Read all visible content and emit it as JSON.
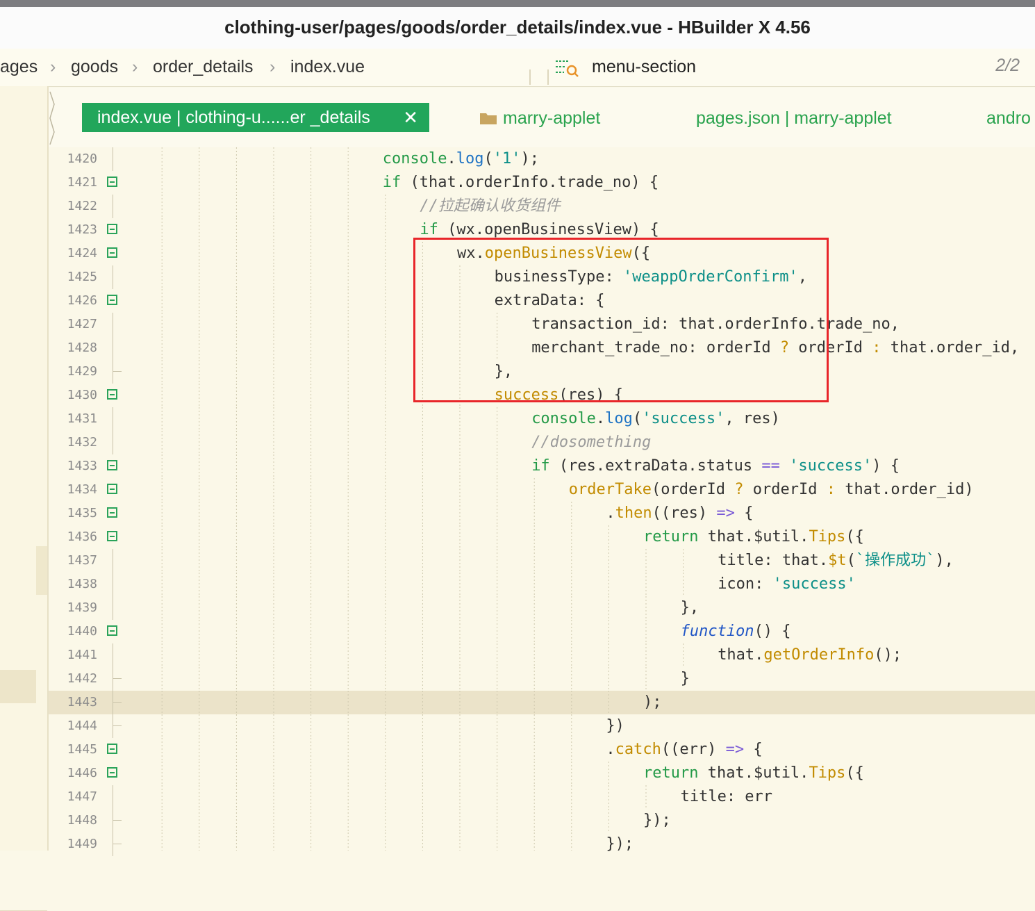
{
  "window": {
    "title": "clothing-user/pages/goods/order_details/index.vue - HBuilder X 4.56"
  },
  "breadcrumb": {
    "items": [
      "ages",
      "goods",
      "order_details",
      "index.vue"
    ],
    "outline_label": "menu-section",
    "match_count": "2/2"
  },
  "tabs": {
    "active": "index.vue | clothing-u......er _details",
    "others": [
      "marry-applet",
      "pages.json | marry-applet",
      "andro"
    ]
  },
  "colors": {
    "accent": "#22a65b",
    "highlight_box": "#e8262a",
    "background": "#fbf8e8"
  },
  "editor": {
    "current_line": 1443,
    "lines": [
      {
        "n": "1420",
        "fold": "",
        "indent": 8,
        "html": "<span class=\"g\">console</span>.<span class=\"b\">log</span>(<span class=\"s\">'1'</span>);"
      },
      {
        "n": "1421",
        "fold": "open",
        "indent": 8,
        "html": "<span class=\"g\">if</span> (that.orderInfo.trade_no) {"
      },
      {
        "n": "1422",
        "fold": "",
        "indent": 9,
        "html": "<span class=\"c\">//拉起确认收货组件</span>"
      },
      {
        "n": "1423",
        "fold": "open",
        "indent": 9,
        "html": "<span class=\"g\">if</span> (wx.openBusinessView) {"
      },
      {
        "n": "1424",
        "fold": "open",
        "indent": 10,
        "html": "wx.<span class=\"o\">openBusinessView</span>({"
      },
      {
        "n": "1425",
        "fold": "",
        "indent": 11,
        "html": "businessType: <span class=\"s\">'weappOrderConfirm'</span>,"
      },
      {
        "n": "1426",
        "fold": "open",
        "indent": 11,
        "html": "extraData: {"
      },
      {
        "n": "1427",
        "fold": "",
        "indent": 12,
        "html": "transaction_id: that.orderInfo.trade_no,"
      },
      {
        "n": "1428",
        "fold": "",
        "indent": 12,
        "html": "merchant_trade_no: orderId <span class=\"o\">?</span> orderId <span class=\"o\">:</span> that.order_id,"
      },
      {
        "n": "1429",
        "fold": "end",
        "indent": 11,
        "html": "},"
      },
      {
        "n": "1430",
        "fold": "open",
        "indent": 11,
        "html": "<span class=\"o\">success</span>(res) {"
      },
      {
        "n": "1431",
        "fold": "",
        "indent": 12,
        "html": "<span class=\"g\">console</span>.<span class=\"b\">log</span>(<span class=\"s\">'success'</span>, res)"
      },
      {
        "n": "1432",
        "fold": "",
        "indent": 12,
        "html": "<span class=\"c\">//dosomething</span>"
      },
      {
        "n": "1433",
        "fold": "open",
        "indent": 12,
        "html": "<span class=\"g\">if</span> (res.extraData.status <span class=\"p\">==</span> <span class=\"s\">'success'</span>) {"
      },
      {
        "n": "1434",
        "fold": "open",
        "indent": 13,
        "html": "<span class=\"o\">orderTake</span>(orderId <span class=\"o\">?</span> orderId <span class=\"o\">:</span> that.order_id)"
      },
      {
        "n": "1435",
        "fold": "open",
        "indent": 14,
        "html": ".<span class=\"o\">then</span>((res) <span class=\"p\">=&gt;</span> {"
      },
      {
        "n": "1436",
        "fold": "open",
        "indent": 15,
        "html": "<span class=\"g\">return</span> that.$util.<span class=\"o\">Tips</span>({"
      },
      {
        "n": "1437",
        "fold": "",
        "indent": 17,
        "html": "title: that.<span class=\"o\">$t</span>(<span class=\"s\">`操作成功`</span>),"
      },
      {
        "n": "1438",
        "fold": "",
        "indent": 17,
        "html": "icon: <span class=\"s\">'success'</span>"
      },
      {
        "n": "1439",
        "fold": "",
        "indent": 16,
        "html": "},"
      },
      {
        "n": "1440",
        "fold": "open",
        "indent": 16,
        "html": "<span class=\"fn\">function</span>() {"
      },
      {
        "n": "1441",
        "fold": "",
        "indent": 17,
        "html": "that.<span class=\"o\">getOrderInfo</span>();"
      },
      {
        "n": "1442",
        "fold": "end",
        "indent": 16,
        "html": "}"
      },
      {
        "n": "1443",
        "fold": "end",
        "indent": 15,
        "html": ");"
      },
      {
        "n": "1444",
        "fold": "end",
        "indent": 14,
        "html": "})"
      },
      {
        "n": "1445",
        "fold": "open",
        "indent": 14,
        "html": ".<span class=\"o\">catch</span>((err) <span class=\"p\">=&gt;</span> {"
      },
      {
        "n": "1446",
        "fold": "open",
        "indent": 15,
        "html": "<span class=\"g\">return</span> that.$util.<span class=\"o\">Tips</span>({"
      },
      {
        "n": "1447",
        "fold": "",
        "indent": 16,
        "html": "title: err"
      },
      {
        "n": "1448",
        "fold": "end",
        "indent": 15,
        "html": "});"
      },
      {
        "n": "1449",
        "fold": "end",
        "indent": 14,
        "html": "});"
      }
    ]
  }
}
